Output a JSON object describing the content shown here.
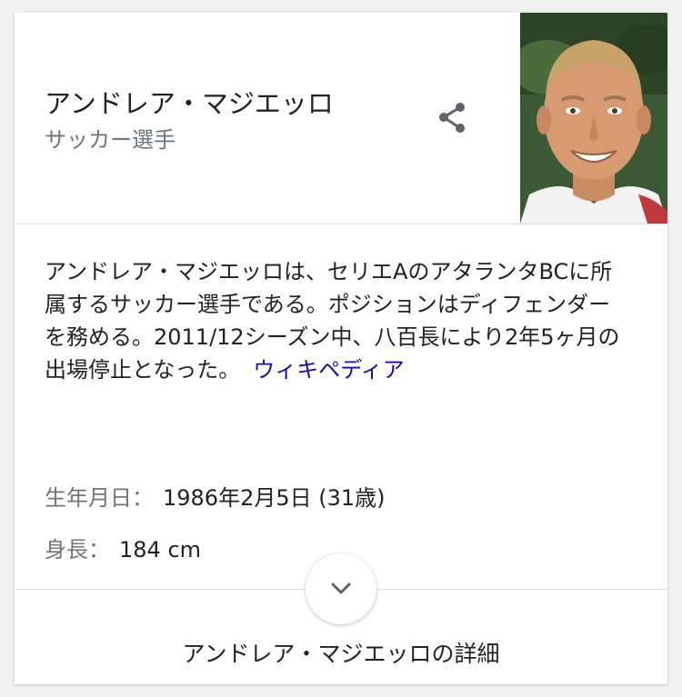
{
  "entity": {
    "name": "アンドレア・マジエッロ",
    "type": "サッカー選手"
  },
  "description": {
    "text": "アンドレア・マジエッロは、セリエAのアタランタBCに所属するサッカー選手である。ポジションはディフェンダーを務める。2011/12シーズン中、八百長により2年5ヶ月の出場停止となった。",
    "source_link": "ウィキペディア"
  },
  "facts": [
    {
      "label": "生年月日：",
      "value": "1986年2月5日 (31歳)"
    },
    {
      "label": "身長：",
      "value": "184 cm"
    }
  ],
  "more_link": "アンドレア・マジエッロの詳細",
  "icons": {
    "share": "share-icon",
    "expand": "chevron-down-icon"
  },
  "colors": {
    "link": "#1a0dab",
    "secondary_text": "#70757a",
    "primary_text": "#222222"
  }
}
